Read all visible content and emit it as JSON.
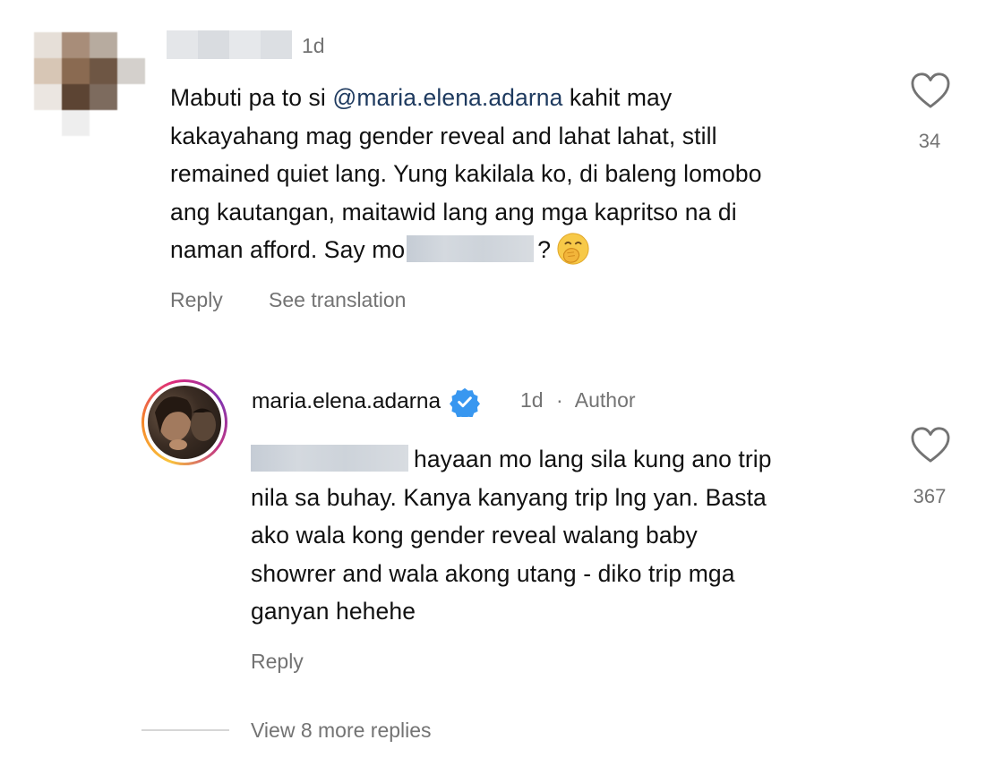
{
  "comment": {
    "timestamp": "1d",
    "text_before_mention": "Mabuti pa to si ",
    "mention": "@maria.elena.adarna",
    "text_line1_after": " kahit may",
    "line2": "kakayahang mag gender reveal and lahat lahat, still",
    "line3": "remained quiet lang. Yung kakilala ko, di baleng lomobo",
    "line4": "ang kautangan, maitawid lang ang mga kapritso na di",
    "line5_start": "naman afford. Say mo",
    "line5_end": "?",
    "emoji": "face-with-hand-over-mouth",
    "likes": "34",
    "actions": {
      "reply": "Reply",
      "translate": "See translation"
    }
  },
  "reply": {
    "username": "maria.elena.adarna",
    "verified": true,
    "timestamp": "1d",
    "separator": "·",
    "badge": "Author",
    "line1": "hayaan mo lang sila kung ano trip",
    "line2": "nila sa buhay. Kanya kanyang trip lng yan. Basta",
    "line3": "ako wala kong gender reveal walang baby",
    "line4": "showrer and wala akong utang - diko trip mga",
    "line5": "ganyan hehehe",
    "likes": "367",
    "actions": {
      "reply": "Reply"
    }
  },
  "view_more": "View 8 more replies",
  "colors": {
    "text": "#111111",
    "muted": "#737373",
    "mention": "#1e3a5f",
    "verified": "#3897f0"
  }
}
